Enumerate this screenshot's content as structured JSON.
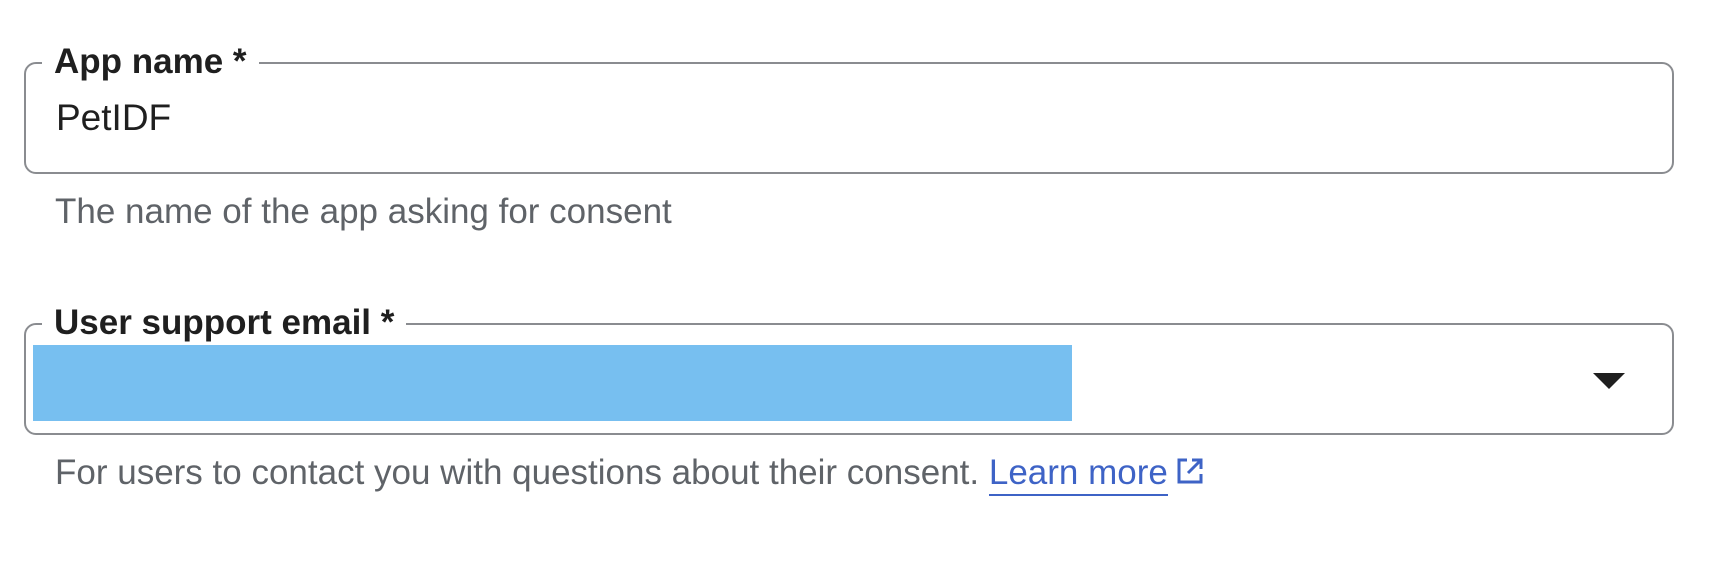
{
  "form": {
    "app_name": {
      "label": "App name *",
      "value": "PetIDF",
      "helper": "The name of the app asking for consent"
    },
    "support_email": {
      "label": "User support email *",
      "value": "",
      "helper": "For users to contact you with questions about their consent.",
      "link_label": "Learn more"
    }
  },
  "icons": {
    "dropdown": "dropdown-arrow-icon",
    "external_link": "external-link-icon"
  },
  "colors": {
    "border": "#8a8c90",
    "text": "#1f1f1f",
    "helper_text": "#5f6368",
    "link": "#3e63c6",
    "redaction": "#77bff0"
  }
}
